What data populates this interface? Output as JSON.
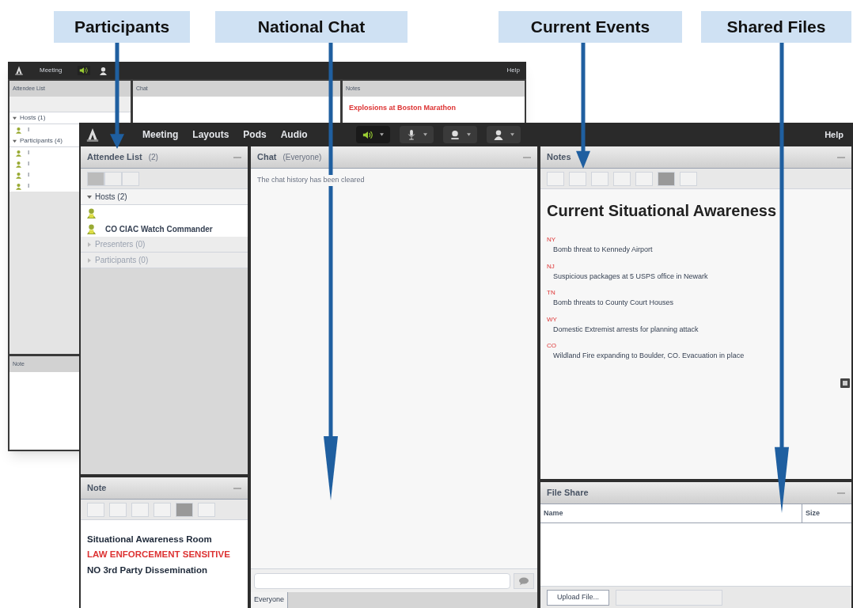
{
  "callouts": [
    {
      "label": "Participants"
    },
    {
      "label": "National Chat"
    },
    {
      "label": "Current Events"
    },
    {
      "label": "Shared Files"
    }
  ],
  "back_window": {
    "menu": [
      "Meeting"
    ],
    "help": "Help",
    "attendee_title": "Attendee List",
    "groups": [
      {
        "label": "Hosts (1)",
        "expanded": true,
        "members": [
          "I"
        ]
      },
      {
        "label": "Participants (4)",
        "expanded": true,
        "members": [
          "I",
          "I",
          "I",
          "I"
        ]
      }
    ],
    "chat_title": "Chat",
    "notes_title": "Notes",
    "notes_headline": "Explosions at Boston Marathon",
    "note_title": "Note"
  },
  "window": {
    "menu": [
      "Meeting",
      "Layouts",
      "Pods",
      "Audio"
    ],
    "toolbar": [
      {
        "kind": "speaker",
        "on": true
      },
      {
        "kind": "mic",
        "on": false
      },
      {
        "kind": "camera",
        "on": false
      },
      {
        "kind": "person",
        "on": false
      }
    ],
    "help": "Help",
    "attendee_list": {
      "title": "Attendee List",
      "count": "(2)",
      "groups": [
        {
          "label": "Hosts (2)",
          "expanded": true,
          "children": [
            {
              "kind": "icon_only"
            },
            {
              "kind": "named",
              "name": "CO CIAC Watch Commander"
            }
          ]
        },
        {
          "label": "Presenters (0)",
          "expanded": false
        },
        {
          "label": "Participants (0)",
          "expanded": false
        }
      ]
    },
    "note": {
      "title": "Note",
      "lines": [
        {
          "text": "Situational Awareness Room",
          "kind": "normal"
        },
        {
          "text": "LAW ENFORCEMENT SENSITIVE",
          "kind": "warning"
        },
        {
          "text": "NO 3rd Party Dissemination",
          "kind": "normal"
        }
      ]
    },
    "chat": {
      "title": "Chat",
      "scope": "(Everyone)",
      "message": "The chat history has been cleared",
      "tabs": [
        {
          "label": "Everyone",
          "selected": true
        }
      ]
    },
    "notes": {
      "title": "Notes",
      "headline": "Current Situational Awareness",
      "items": [
        {
          "state": "NY",
          "text": "Bomb threat to Kennedy Airport"
        },
        {
          "state": "NJ",
          "text": "Suspicious packages at 5 USPS office in Newark"
        },
        {
          "state": "TN",
          "text": "Bomb threats to County Court Houses"
        },
        {
          "state": "WY",
          "text": "Domestic Extremist arrests for planning attack"
        },
        {
          "state": "CO",
          "text": "Wildland Fire expanding to Boulder, CO.  Evacuation in place"
        }
      ]
    },
    "file_share": {
      "title": "File Share",
      "columns": [
        "Name",
        "Size"
      ],
      "upload": "Upload File..."
    }
  }
}
